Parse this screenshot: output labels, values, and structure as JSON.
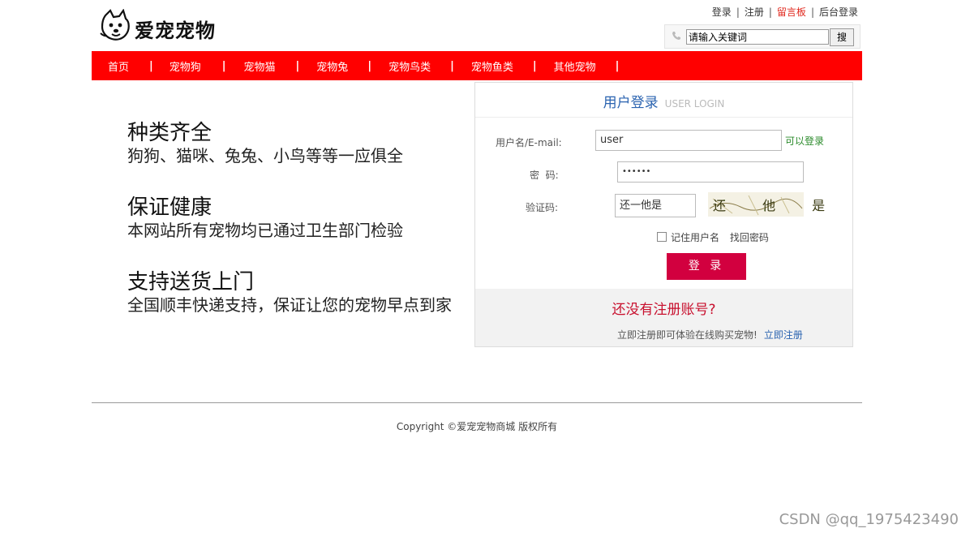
{
  "header": {
    "brand": "爱宠宠物",
    "logo_icon": "dog-head-icon",
    "links": {
      "login": "登录",
      "register": "注册",
      "guestbook": "留言板",
      "admin": "后台登录",
      "separator": "|"
    },
    "search": {
      "value": "请输入关键词",
      "button": "搜",
      "icon": "phone-icon"
    }
  },
  "nav": {
    "items": [
      "首页",
      "宠物狗",
      "宠物猫",
      "宠物兔",
      "宠物鸟类",
      "宠物鱼类",
      "其他宠物"
    ],
    "separator": "|",
    "bg_color": "#ff0000"
  },
  "features": [
    {
      "title": "种类齐全",
      "desc": "狗狗、猫咪、兔兔、小鸟等等一应俱全"
    },
    {
      "title": "保证健康",
      "desc": "本网站所有宠物均已通过卫生部门检验"
    },
    {
      "title": "支持送货上门",
      "desc": "全国顺丰快递支持，保证让您的宠物早点到家"
    }
  ],
  "login": {
    "title": "用户登录",
    "title_en": "USER LOGIN",
    "username_label": "用户名/E-mail:",
    "username_value": "user",
    "username_status": "可以登录",
    "password_label": "密  码:",
    "password_value": "••••••",
    "captcha_label": "验证码:",
    "captcha_value": "还一他是",
    "captcha_image_text": "还 他 是",
    "remember_label": "记住用户名",
    "forgot_label": "找回密码",
    "submit_label": "登 录",
    "no_account": "还没有注册账号?",
    "register_prompt": "立即注册即可体验在线购买宠物!",
    "register_link": "立即注册",
    "button_color": "#d2003f"
  },
  "footer": {
    "copyright": "Copyright ©爱宠宠物商城 版权所有",
    "watermark": "CSDN @qq_1975423490"
  }
}
